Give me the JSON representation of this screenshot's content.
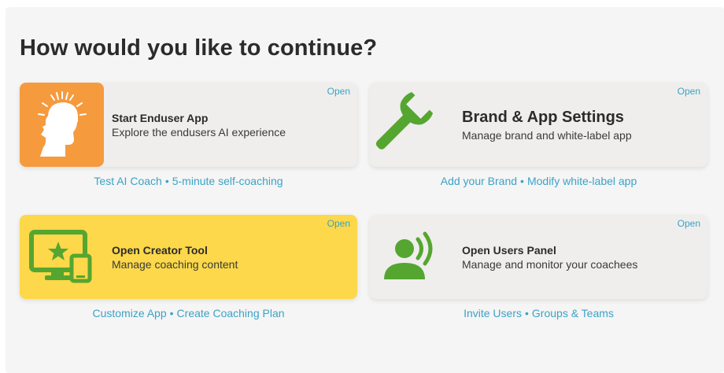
{
  "heading": "How would you like to continue?",
  "open_label": "Open",
  "cards": [
    {
      "title": "Start Enduser App",
      "description": "Explore the endusers AI experience",
      "links": [
        "Test AI Coach",
        "5-minute self-coaching"
      ]
    },
    {
      "title": "Brand & App Settings",
      "description": "Manage brand and white-label app",
      "links": [
        "Add your Brand",
        "Modify white-label app"
      ]
    },
    {
      "title": "Open Creator Tool",
      "description": "Manage coaching content",
      "links": [
        "Customize App",
        "Create Coaching Plan"
      ]
    },
    {
      "title": "Open Users Panel",
      "description": "Manage and monitor your coachees",
      "links": [
        "Invite Users",
        "Groups & Teams"
      ]
    }
  ],
  "link_separator": "•",
  "colors": {
    "accent_link": "#3aa3c6",
    "icon_green": "#55a630",
    "orange": "#f69a3e",
    "yellow": "#fcd84a"
  },
  "icons": [
    "head-sun-icon",
    "wrench-icon",
    "monitor-star-icon",
    "user-signal-icon"
  ]
}
